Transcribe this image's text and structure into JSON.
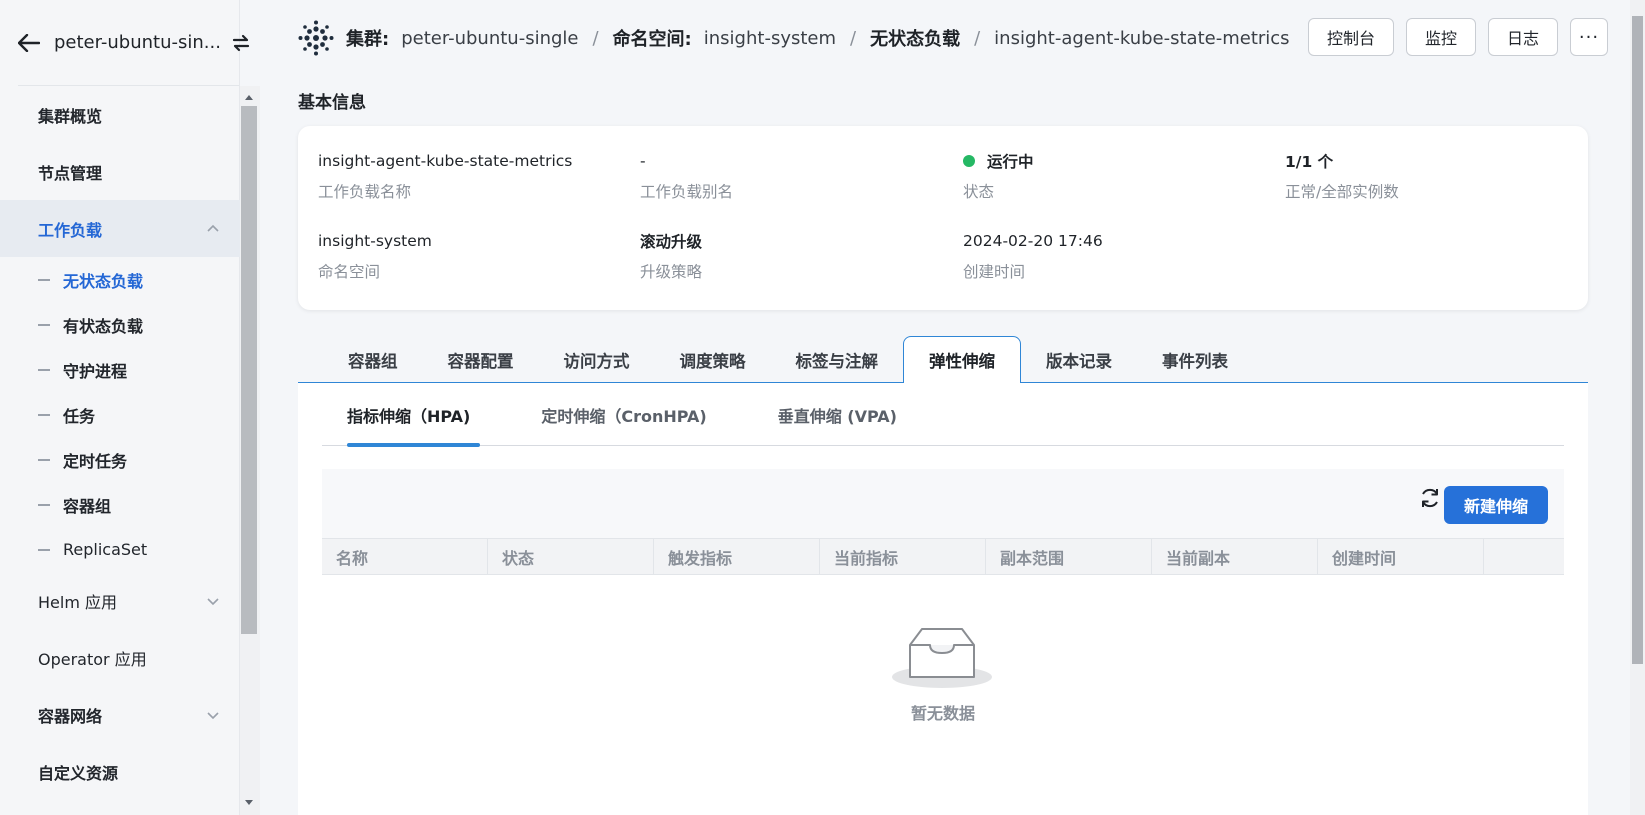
{
  "sidebar": {
    "cluster_name": "peter-ubuntu-sin...",
    "items": [
      {
        "label": "集群概览"
      },
      {
        "label": "节点管理"
      },
      {
        "label": "工作负载"
      },
      {
        "label": "Helm 应用"
      },
      {
        "label": "Operator 应用"
      },
      {
        "label": "容器网络"
      },
      {
        "label": "自定义资源"
      }
    ],
    "workload_sub": [
      {
        "label": "无状态负载"
      },
      {
        "label": "有状态负载"
      },
      {
        "label": "守护进程"
      },
      {
        "label": "任务"
      },
      {
        "label": "定时任务"
      },
      {
        "label": "容器组"
      },
      {
        "label": "ReplicaSet"
      }
    ]
  },
  "breadcrumb": {
    "cluster_key": "集群:",
    "cluster_val": "peter-ubuntu-single",
    "namespace_key": "命名空间:",
    "namespace_val": "insight-system",
    "workload_key": "无状态负载",
    "workload_val": "insight-agent-kube-state-metrics",
    "sep": "/"
  },
  "actions": {
    "console": "控制台",
    "monitor": "监控",
    "logs": "日志",
    "more": "···"
  },
  "basic_info": {
    "title": "基本信息",
    "name_val": "insight-agent-kube-state-metrics",
    "name_lbl": "工作负载名称",
    "alias_val": "-",
    "alias_lbl": "工作负载别名",
    "status_val": "运行中",
    "status_lbl": "状态",
    "status_color": "#25b864",
    "replicas_val": "1/1 个",
    "replicas_lbl": "正常/全部实例数",
    "ns_val": "insight-system",
    "ns_lbl": "命名空间",
    "strategy_val": "滚动升级",
    "strategy_lbl": "升级策略",
    "created_val": "2024-02-20 17:46",
    "created_lbl": "创建时间"
  },
  "tabs": [
    {
      "label": "容器组"
    },
    {
      "label": "容器配置"
    },
    {
      "label": "访问方式"
    },
    {
      "label": "调度策略"
    },
    {
      "label": "标签与注解"
    },
    {
      "label": "弹性伸缩"
    },
    {
      "label": "版本记录"
    },
    {
      "label": "事件列表"
    }
  ],
  "subtabs": [
    {
      "label": "指标伸缩（HPA)"
    },
    {
      "label": "定时伸缩（CronHPA)"
    },
    {
      "label": "垂直伸缩 (VPA)"
    }
  ],
  "table": {
    "create_button": "新建伸缩",
    "columns": [
      "名称",
      "状态",
      "触发指标",
      "当前指标",
      "副本范围",
      "当前副本",
      "创建时间",
      ""
    ],
    "empty_text": "暂无数据"
  },
  "colors": {
    "accent": "#2671d9",
    "active_nav": "#2467d5",
    "tab_border": "#2f86d6"
  }
}
